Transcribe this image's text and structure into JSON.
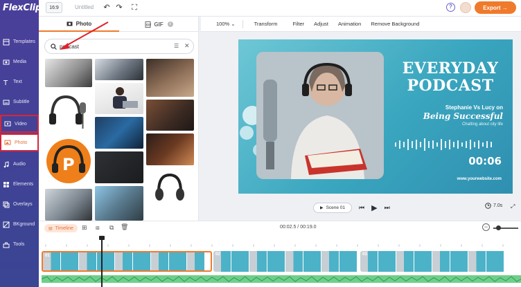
{
  "app": {
    "logo": "FlexClip",
    "title": "Untitled",
    "ratio": "16:9",
    "export_label": "Export →"
  },
  "sidebar": {
    "items": [
      {
        "label": "Templates",
        "icon": "templates-icon"
      },
      {
        "label": "Media",
        "icon": "media-icon"
      },
      {
        "label": "Text",
        "icon": "text-icon"
      },
      {
        "label": "Subtitle",
        "icon": "subtitle-icon"
      },
      {
        "label": "Video",
        "icon": "video-icon"
      },
      {
        "label": "Photo",
        "icon": "photo-icon"
      },
      {
        "label": "Audio",
        "icon": "audio-icon"
      },
      {
        "label": "Elements",
        "icon": "elements-icon"
      },
      {
        "label": "Overlays",
        "icon": "overlays-icon"
      },
      {
        "label": "BKground",
        "icon": "background-icon"
      },
      {
        "label": "Tools",
        "icon": "tools-icon"
      }
    ]
  },
  "panel": {
    "tabs": [
      {
        "label": "Photo"
      },
      {
        "label": "GIF"
      }
    ],
    "search": {
      "value": "podcast",
      "placeholder": ""
    }
  },
  "editor": {
    "zoom": "100%",
    "toolbar": [
      "Transform",
      "Filter",
      "Adjust",
      "Animation",
      "Remove Background"
    ],
    "slide": {
      "title_line1": "EVERYDAY",
      "title_line2": "PODCAST",
      "names": "Stephanie Vs Lucy on",
      "headline": "Being Successful",
      "tagline": "Chatting about city life",
      "timer": "00:06",
      "website": "www.yourwebsite.com"
    },
    "scene_label": "Scene 01",
    "duration": "7.0s"
  },
  "timeline": {
    "label": "Timeline",
    "time": "00:02.5 / 00:19.0",
    "scene1_number": "01",
    "scene2_number": "02",
    "scene3_number": "03"
  },
  "colors": {
    "accent": "#f07a2c",
    "rail": "#41419a",
    "teal": "#3aa6bf"
  }
}
